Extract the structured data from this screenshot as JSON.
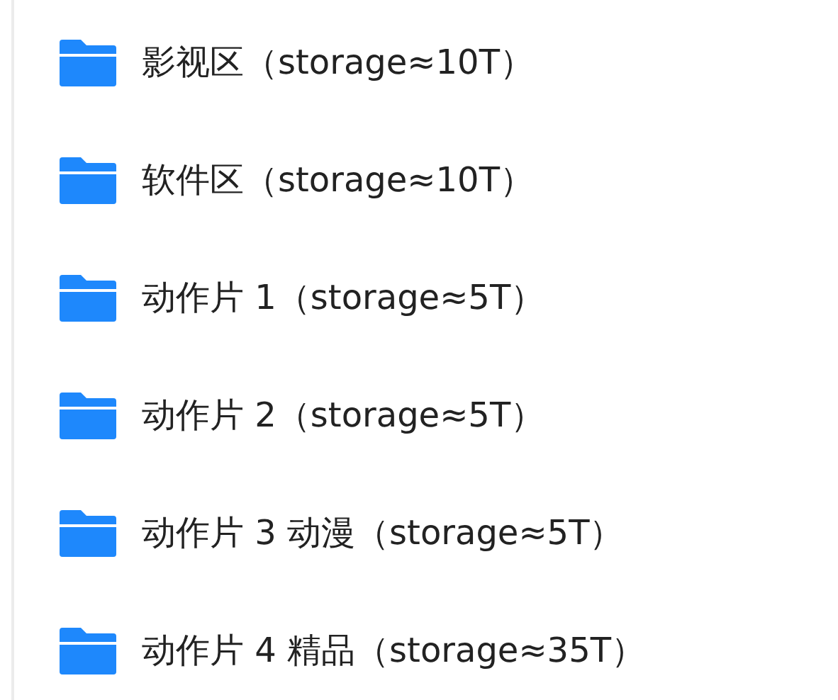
{
  "folders": [
    {
      "name": "影视区（storage≈10T）"
    },
    {
      "name": "软件区（storage≈10T）"
    },
    {
      "name": "动作片 1（storage≈5T）"
    },
    {
      "name": "动作片 2（storage≈5T）"
    },
    {
      "name": "动作片 3 动漫（storage≈5T）"
    },
    {
      "name": "动作片 4 精品（storage≈35T）"
    }
  ]
}
